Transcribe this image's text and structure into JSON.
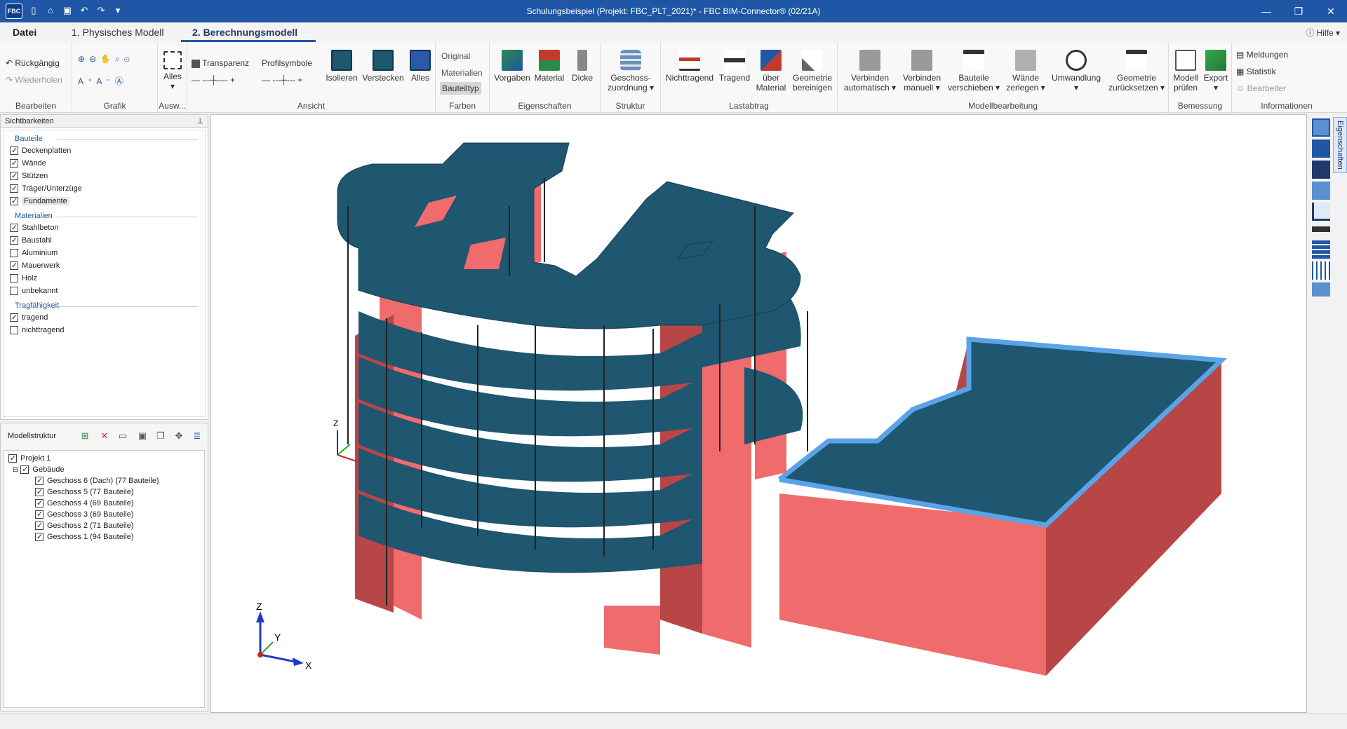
{
  "app": {
    "logo": "FBC",
    "title": "Schulungsbeispiel (Projekt: FBC_PLT_2021)*  -  FBC BIM-Connector® (02/21A)",
    "minimize": "—",
    "maximize": "❐",
    "close": "✕"
  },
  "tabs": {
    "datei": "Datei",
    "physisch": "1. Physisches Modell",
    "berechnung": "2. Berechnungsmodell",
    "help": "Hilfe"
  },
  "ribbon": {
    "bearbeiten": {
      "label": "Bearbeiten",
      "undo": "Rückgängig",
      "redo": "Wiederholen"
    },
    "grafik": {
      "label": "Grafik"
    },
    "ausw": {
      "label": "Ausw...",
      "alles": "Alles"
    },
    "ansicht": {
      "label": "Ansicht",
      "transparenz": "Transparenz",
      "profilsymbole": "Profilsymbole",
      "isolieren": "Isolieren",
      "verstecken": "Verstecken",
      "alles": "Alles"
    },
    "farben": {
      "label": "Farben",
      "original": "Original",
      "materialien": "Materialien",
      "bauteiltyp": "Bauteiltyp"
    },
    "eigenschaften": {
      "label": "Eigenschaften",
      "vorgaben": "Vorgaben",
      "material": "Material",
      "dicke": "Dicke"
    },
    "struktur": {
      "label": "Struktur",
      "geschoss1": "Geschoss-",
      "geschoss2": "zuordnung"
    },
    "lastabtrag": {
      "label": "Lastabtrag",
      "nichttragend": "Nichttragend",
      "tragend": "Tragend",
      "ueber1": "über",
      "ueber2": "Material",
      "geo1": "Geometrie",
      "geo2": "bereinigen"
    },
    "modellbearbeitung": {
      "label": "Modellbearbeitung",
      "va1": "Verbinden",
      "va2": "automatisch",
      "vm1": "Verbinden",
      "vm2": "manuell",
      "bv1": "Bauteile",
      "bv2": "verschieben",
      "wz1": "Wände",
      "wz2": "zerlegen",
      "um": "Umwandlung",
      "gz1": "Geometrie",
      "gz2": "zurücksetzen"
    },
    "bemessung": {
      "label": "Bemessung",
      "mp1": "Modell",
      "mp2": "prüfen",
      "export": "Export"
    },
    "informationen": {
      "label": "Informationen",
      "meldungen": "Meldungen",
      "statistik": "Statistik",
      "bearbeiter": "Bearbeiter"
    }
  },
  "visibility": {
    "title": "Sichtbarkeiten",
    "bauteile": "Bauteile",
    "deckenplatten": "Deckenplatten",
    "waende": "Wände",
    "stuetzen": "Stützen",
    "traeger": "Träger/Unterzüge",
    "fundamente": "Fundamente",
    "materialien": "Materialien",
    "stahlbeton": "Stahlbeton",
    "baustahl": "Baustahl",
    "aluminium": "Aluminium",
    "mauerwerk": "Mauerwerk",
    "holz": "Holz",
    "unbekannt": "unbekannt",
    "tragfaehigkeit": "Tragfähigkeit",
    "tragend": "tragend",
    "nichttragend": "nichttragend"
  },
  "tree": {
    "title": "Modellstruktur",
    "projekt": "Projekt 1",
    "gebaeude": "Gebäude",
    "g6": "Geschoss 6 (Dach) (77 Bauteile)",
    "g5": "Geschoss 5 (77 Bauteile)",
    "g4": "Geschoss 4 (69 Bauteile)",
    "g3": "Geschoss 3 (69 Bauteile)",
    "g2": "Geschoss 2 (71 Bauteile)",
    "g1": "Geschoss 1 (94 Bauteile)"
  },
  "viewport": {
    "axis_x": "X",
    "axis_y": "Y",
    "axis_z": "Z"
  },
  "rightbar": {
    "tab": "Eigenschaften"
  },
  "colors": {
    "slab": "#1f5670",
    "wall": "#f06b6b",
    "wall_dark": "#b84646",
    "highlight": "#5ba3e8",
    "accent": "#1f57a6"
  }
}
